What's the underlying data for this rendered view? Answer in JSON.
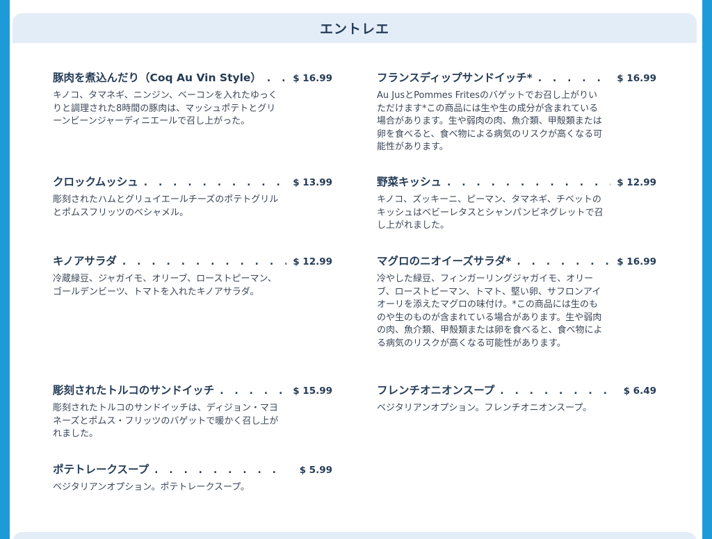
{
  "section": {
    "title": "エントレエ"
  },
  "items": [
    {
      "name": "豚肉を煮込んだり（Coq Au Vin Style）",
      "price": "$ 16.99",
      "description": "キノコ、タマネギ、ニンジン、ベーコンを入れたゆっくりと調理された8時間の豚肉は、マッシュポテトとグリーンビーンジャーディニエールで召し上がった。"
    },
    {
      "name": "フランスディップサンドイッチ*",
      "price": "$ 16.99",
      "description": "Au JusとPommes Fritesのバゲットでお召し上がりいただけます*この商品には生や生の成分が含まれている場合があります。生や弱肉の肉、魚介類、甲殻類または卵を食べると、食べ物による病気のリスクが高くなる可能性があります。"
    },
    {
      "name": "クロックムッシュ",
      "price": "$ 13.99",
      "description": "彫刻されたハムとグリュイエールチーズのポテトグリルとポムスフリッツのベシャメル。"
    },
    {
      "name": "野菜キッシュ",
      "price": "$ 12.99",
      "description": "キノコ、ズッキーニ、ピーマン、タマネギ、チベットのキッシュはベビーレタスとシャンパンビネグレットで召し上がれました。"
    },
    {
      "name": "キノアサラダ",
      "price": "$ 12.99",
      "description": "冷蔵緑豆、ジャガイモ、オリーブ、ローストピーマン、ゴールデンビーツ、トマトを入れたキノアサラダ。"
    },
    {
      "name": "マグロのニオイーズサラダ*",
      "price": "$ 16.99",
      "description": "冷やした緑豆、フィンガーリングジャガイモ、オリーブ、ローストピーマン、トマト、堅い卵、サフロンアイオーリを添えたマグロの味付け。*この商品には生のものや生のものが含まれている場合があります。生や弱肉の肉、魚介類、甲殻類または卵を食べると、食べ物による病気のリスクが高くなる可能性があります。"
    },
    {
      "name": "彫刻されたトルコのサンドイッチ",
      "price": "$ 15.99",
      "description": "彫刻されたトルコのサンドイッチは、ディジョン・マヨネーズとポムス・フリッツのバゲットで暖かく召し上がれました。"
    },
    {
      "name": "フレンチオニオンスープ",
      "price": "$ 6.49",
      "description": "ベジタリアンオプション。フレンチオニオンスープ。"
    },
    {
      "name": "ポテトレークスープ",
      "price": "$ 5.99",
      "description": "ベジタリアンオプション。ポテトレークスープ。"
    }
  ]
}
